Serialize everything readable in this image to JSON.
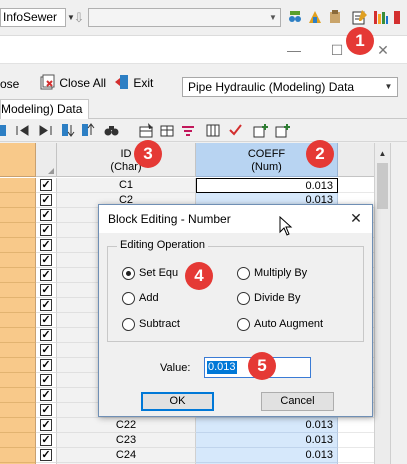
{
  "toolbar": {
    "app_combo": "InfoSewer",
    "main_combo_value": "",
    "icons": [
      "tool-icon-1",
      "tool-icon-2",
      "tool-icon-3",
      "edit-data-icon",
      "report-icon"
    ]
  },
  "child_window": {
    "title": "",
    "close_text": "ose",
    "close_all_label": "Close All",
    "exit_label": "Exit",
    "table_select_value": "Pipe Hydraulic (Modeling) Data",
    "active_tab_label": "Modeling) Data"
  },
  "grid": {
    "headers": {
      "id": "ID",
      "id_type": "(Char)",
      "coeff": "COEFF",
      "coeff_type": "(Num)"
    },
    "rows": [
      {
        "id": "C1",
        "coeff": "0.013",
        "checked": true
      },
      {
        "id": "C2",
        "coeff": "0.013",
        "checked": true
      },
      {
        "id": "",
        "coeff": "",
        "checked": true
      },
      {
        "id": "",
        "coeff": "",
        "checked": true
      },
      {
        "id": "",
        "coeff": "",
        "checked": true
      },
      {
        "id": "",
        "coeff": "",
        "checked": true
      },
      {
        "id": "",
        "coeff": "",
        "checked": true
      },
      {
        "id": "",
        "coeff": "",
        "checked": true
      },
      {
        "id": "",
        "coeff": "",
        "checked": true
      },
      {
        "id": "",
        "coeff": "",
        "checked": true
      },
      {
        "id": "",
        "coeff": "",
        "checked": true
      },
      {
        "id": "",
        "coeff": "",
        "checked": true
      },
      {
        "id": "",
        "coeff": "",
        "checked": true
      },
      {
        "id": "",
        "coeff": "",
        "checked": true
      },
      {
        "id": "",
        "coeff": "",
        "checked": true
      },
      {
        "id": "",
        "coeff": "",
        "checked": true
      },
      {
        "id": "C22",
        "coeff": "0.013",
        "checked": true
      },
      {
        "id": "C23",
        "coeff": "0.013",
        "checked": true
      },
      {
        "id": "C24",
        "coeff": "0.013",
        "checked": true
      },
      {
        "id": "",
        "coeff": "",
        "checked": true
      }
    ]
  },
  "dialog": {
    "title": "Block Editing - Number",
    "group_label": "Editing Operation",
    "options": [
      {
        "label": "Set Equ",
        "selected": true
      },
      {
        "label": "Multiply By",
        "selected": false
      },
      {
        "label": "Add",
        "selected": false
      },
      {
        "label": "Divide By",
        "selected": false
      },
      {
        "label": "Subtract",
        "selected": false
      },
      {
        "label": "Auto Augment",
        "selected": false
      }
    ],
    "value_label": "Value:",
    "value": "0.013",
    "ok_label": "OK",
    "cancel_label": "Cancel"
  },
  "callouts": [
    "1",
    "2",
    "3",
    "4",
    "5"
  ],
  "colors": {
    "callout": "#e53935",
    "coeff_column": "#d6e8fb",
    "row_header": "#f8c98a"
  }
}
